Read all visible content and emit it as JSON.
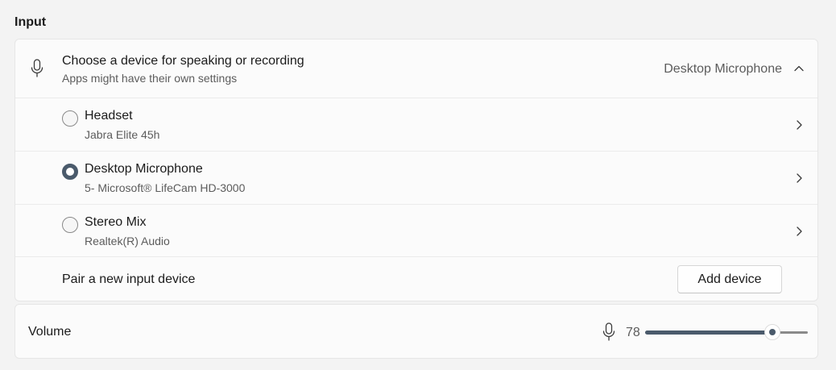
{
  "section": {
    "title": "Input"
  },
  "device_picker": {
    "title": "Choose a device for speaking or recording",
    "subtitle": "Apps might have their own settings",
    "selected": "Desktop Microphone",
    "icon": "microphone-icon",
    "expand_icon": "chevron-up-icon"
  },
  "devices": [
    {
      "name": "Headset",
      "description": "Jabra Elite 45h",
      "selected": false
    },
    {
      "name": "Desktop Microphone",
      "description": "5- Microsoft® LifeCam HD-3000",
      "selected": true
    },
    {
      "name": "Stereo Mix",
      "description": "Realtek(R) Audio",
      "selected": false
    }
  ],
  "pair": {
    "label": "Pair a new input device",
    "button_label": "Add device"
  },
  "volume": {
    "label": "Volume",
    "value": "78",
    "level_percent": 78,
    "icon": "microphone-icon"
  },
  "colors": {
    "accent": "#4a5a6b",
    "background": "#f3f3f3",
    "card": "#fbfbfb",
    "secondary_text": "#5c5c5c"
  }
}
